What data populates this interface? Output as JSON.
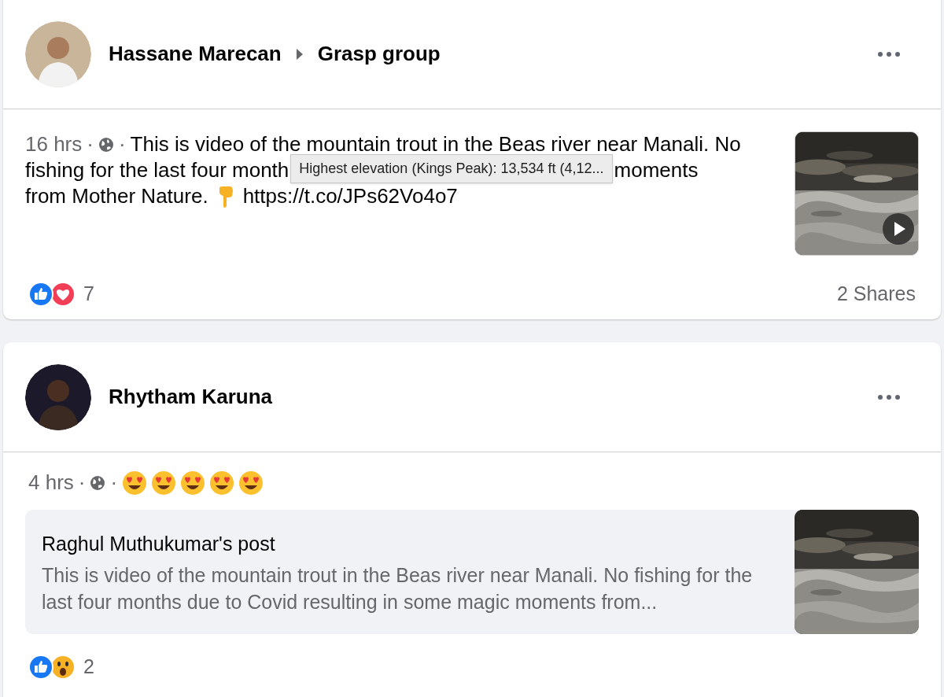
{
  "posts": [
    {
      "author": "Hassane Marecan",
      "group": "Grasp group",
      "time": "16 hrs",
      "dot": "·",
      "lines": [
        [
          {
            "kind": "text",
            "text": "This is video of the mountain trout in the Beas river near Manali. No"
          }
        ],
        [
          {
            "kind": "text",
            "text": "fishing for the last four month"
          },
          {
            "kind": "tooltip",
            "text": "Highest elevation (Kings Peak): 13,534 ft (4,12..."
          },
          {
            "kind": "text",
            "text": "moments"
          }
        ],
        [
          {
            "kind": "text",
            "text": "from Mother Nature."
          },
          {
            "kind": "emoji"
          },
          {
            "kind": "text",
            "text": "https://t.co/JPs62Vo4o7"
          }
        ]
      ],
      "media": {
        "kind": "video"
      },
      "reactions": [
        {
          "kind": "like"
        },
        {
          "kind": "love"
        }
      ],
      "reaction_count": "7",
      "shares": "2 Shares"
    },
    {
      "author": "Rhytham Karuna",
      "time": "4 hrs",
      "dot": "·",
      "emojis": [
        {
          "kind": "heart-eyes"
        },
        {
          "kind": "heart-eyes"
        },
        {
          "kind": "heart-eyes"
        },
        {
          "kind": "heart-eyes"
        },
        {
          "kind": "heart-eyes"
        }
      ],
      "shared": {
        "title": "Raghul Muthukumar's post",
        "excerpt": "This is video of the mountain trout in the Beas river near Manali. No fishing for the last four months due to Covid resulting in some magic moments from..."
      },
      "reactions": [
        {
          "kind": "like"
        },
        {
          "kind": "wow"
        }
      ],
      "reaction_count": "2"
    }
  ]
}
